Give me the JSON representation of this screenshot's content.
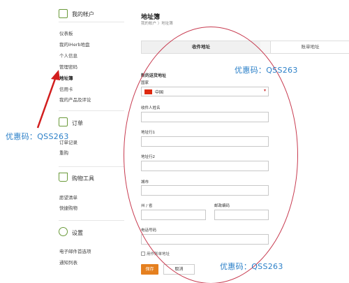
{
  "sidebar": {
    "account": {
      "title": "我的帐户",
      "items": [
        "仪表板",
        "我的iHerb地盘",
        "个人信息",
        "管理密码",
        "地址簿",
        "信用卡",
        "我的产品及评论"
      ],
      "active": "地址簿"
    },
    "orders": {
      "title": "订单",
      "items": [
        "订单记录",
        "重购"
      ]
    },
    "tools": {
      "title": "购物工具",
      "items": [
        "愿望清单",
        "快捷购物"
      ]
    },
    "settings": {
      "title": "设置",
      "items": [
        "电子邮件首选项",
        "通知列表"
      ]
    }
  },
  "main": {
    "title": "地址簿",
    "breadcrumb": "我的帐户  〉地址簿",
    "tabs": {
      "shipping": "收件地址",
      "billing": "账单地址"
    },
    "form": {
      "heading": "新的送货地址",
      "country_label": "国家",
      "country_value": "中国",
      "name_label": "收件人姓名",
      "address1_label": "地址行1",
      "address2_label": "地址行2",
      "city_label": "城市",
      "state_label": "州 / 省",
      "postal_label": "邮政编码",
      "phone_label": "电话号码",
      "checkbox_label": "用作账单地址",
      "save_label": "保存",
      "cancel_label": "取消"
    }
  },
  "promo": {
    "text": "优惠码：QSS263"
  },
  "colors": {
    "accent": "#e5801f",
    "promo": "#2a7fc8",
    "annotation": "#c73a4f",
    "icon": "#6a9a3a"
  },
  "icons": [
    "user-icon",
    "orders-icon",
    "cart-icon",
    "gear-icon",
    "flag-cn-icon",
    "chevron-down-icon"
  ]
}
